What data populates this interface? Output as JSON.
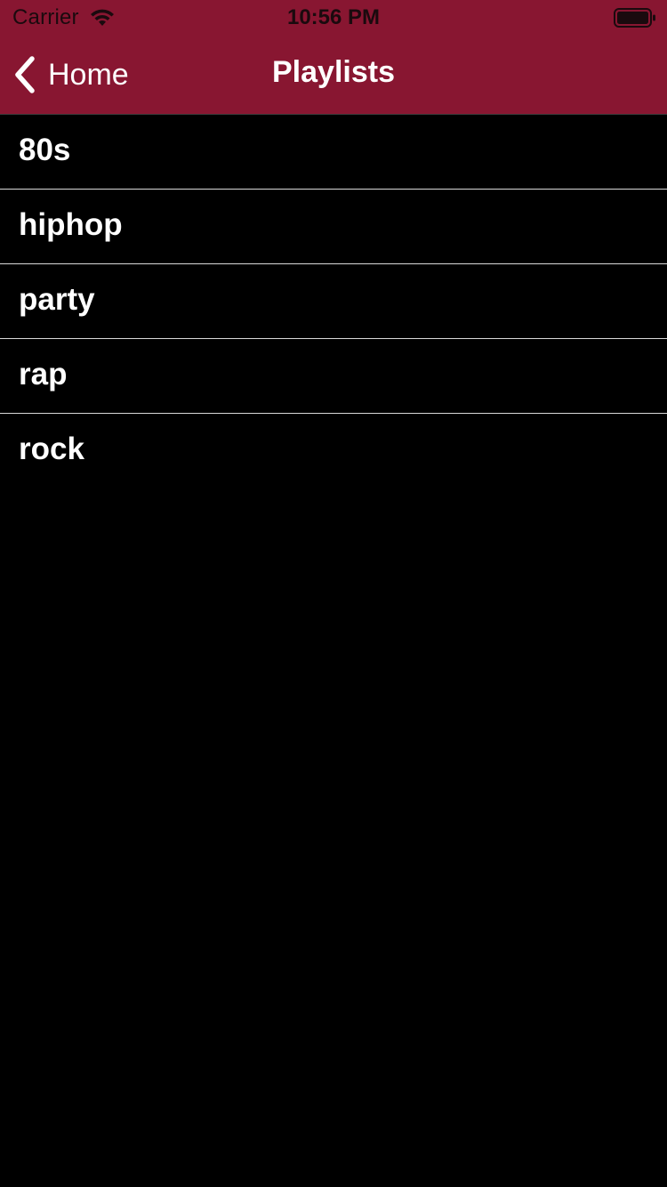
{
  "status_bar": {
    "carrier": "Carrier",
    "time": "10:56 PM",
    "wifi_icon": "wifi-icon",
    "battery_icon": "battery-icon"
  },
  "nav": {
    "back_label": "Home",
    "back_icon": "chevron-left-icon",
    "title": "Playlists"
  },
  "playlists": [
    {
      "label": "80s"
    },
    {
      "label": "hiphop"
    },
    {
      "label": "party"
    },
    {
      "label": "rap"
    },
    {
      "label": "rock"
    }
  ],
  "colors": {
    "bar_background": "#881631",
    "screen_background": "#000000",
    "text": "#ffffff",
    "separator": "#d9d9d9"
  }
}
